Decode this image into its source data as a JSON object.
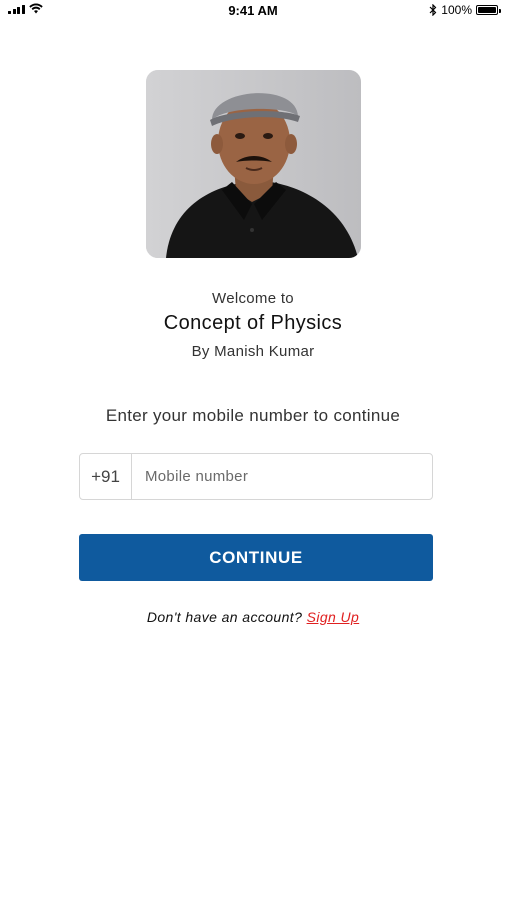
{
  "status_bar": {
    "time": "9:41 AM",
    "battery_percent": "100%",
    "icons": [
      "cellular-signal-icon",
      "wifi-icon",
      "bluetooth-icon",
      "battery-icon"
    ]
  },
  "welcome": {
    "greeting": "Welcome to",
    "title": "Concept of Physics",
    "author": "By Manish Kumar"
  },
  "login": {
    "prompt": "Enter your mobile number to continue",
    "country_code": "+91",
    "mobile_placeholder": "Mobile number",
    "mobile_value": "",
    "continue_label": "CONTINUE",
    "no_account_text": "Don't have an account?",
    "signup_label": "Sign Up"
  },
  "colors": {
    "primary": "#0f5a9e",
    "link": "#e02020",
    "border": "#d6d6d6",
    "background": "#ffffff"
  }
}
